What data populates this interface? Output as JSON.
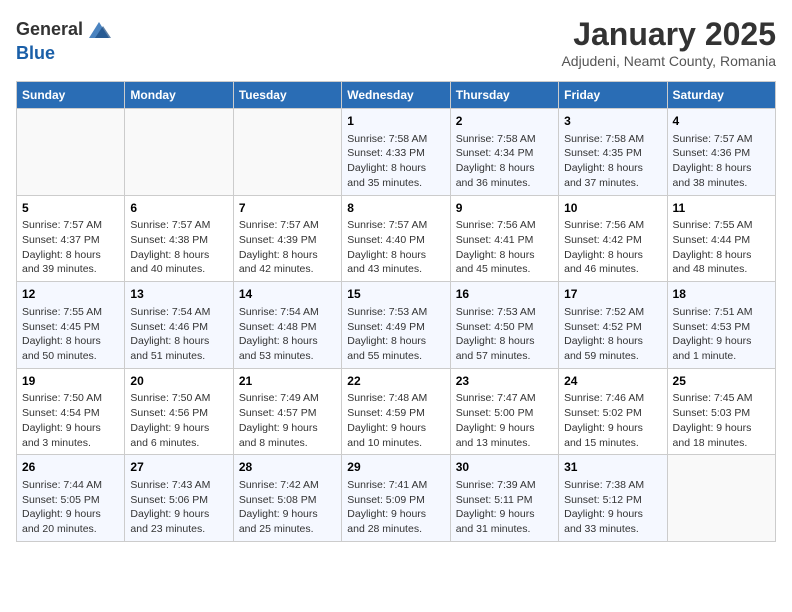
{
  "header": {
    "logo_general": "General",
    "logo_blue": "Blue",
    "month_title": "January 2025",
    "subtitle": "Adjudeni, Neamt County, Romania"
  },
  "calendar": {
    "days_of_week": [
      "Sunday",
      "Monday",
      "Tuesday",
      "Wednesday",
      "Thursday",
      "Friday",
      "Saturday"
    ],
    "weeks": [
      [
        {
          "day": "",
          "info": ""
        },
        {
          "day": "",
          "info": ""
        },
        {
          "day": "",
          "info": ""
        },
        {
          "day": "1",
          "info": "Sunrise: 7:58 AM\nSunset: 4:33 PM\nDaylight: 8 hours and 35 minutes."
        },
        {
          "day": "2",
          "info": "Sunrise: 7:58 AM\nSunset: 4:34 PM\nDaylight: 8 hours and 36 minutes."
        },
        {
          "day": "3",
          "info": "Sunrise: 7:58 AM\nSunset: 4:35 PM\nDaylight: 8 hours and 37 minutes."
        },
        {
          "day": "4",
          "info": "Sunrise: 7:57 AM\nSunset: 4:36 PM\nDaylight: 8 hours and 38 minutes."
        }
      ],
      [
        {
          "day": "5",
          "info": "Sunrise: 7:57 AM\nSunset: 4:37 PM\nDaylight: 8 hours and 39 minutes."
        },
        {
          "day": "6",
          "info": "Sunrise: 7:57 AM\nSunset: 4:38 PM\nDaylight: 8 hours and 40 minutes."
        },
        {
          "day": "7",
          "info": "Sunrise: 7:57 AM\nSunset: 4:39 PM\nDaylight: 8 hours and 42 minutes."
        },
        {
          "day": "8",
          "info": "Sunrise: 7:57 AM\nSunset: 4:40 PM\nDaylight: 8 hours and 43 minutes."
        },
        {
          "day": "9",
          "info": "Sunrise: 7:56 AM\nSunset: 4:41 PM\nDaylight: 8 hours and 45 minutes."
        },
        {
          "day": "10",
          "info": "Sunrise: 7:56 AM\nSunset: 4:42 PM\nDaylight: 8 hours and 46 minutes."
        },
        {
          "day": "11",
          "info": "Sunrise: 7:55 AM\nSunset: 4:44 PM\nDaylight: 8 hours and 48 minutes."
        }
      ],
      [
        {
          "day": "12",
          "info": "Sunrise: 7:55 AM\nSunset: 4:45 PM\nDaylight: 8 hours and 50 minutes."
        },
        {
          "day": "13",
          "info": "Sunrise: 7:54 AM\nSunset: 4:46 PM\nDaylight: 8 hours and 51 minutes."
        },
        {
          "day": "14",
          "info": "Sunrise: 7:54 AM\nSunset: 4:48 PM\nDaylight: 8 hours and 53 minutes."
        },
        {
          "day": "15",
          "info": "Sunrise: 7:53 AM\nSunset: 4:49 PM\nDaylight: 8 hours and 55 minutes."
        },
        {
          "day": "16",
          "info": "Sunrise: 7:53 AM\nSunset: 4:50 PM\nDaylight: 8 hours and 57 minutes."
        },
        {
          "day": "17",
          "info": "Sunrise: 7:52 AM\nSunset: 4:52 PM\nDaylight: 8 hours and 59 minutes."
        },
        {
          "day": "18",
          "info": "Sunrise: 7:51 AM\nSunset: 4:53 PM\nDaylight: 9 hours and 1 minute."
        }
      ],
      [
        {
          "day": "19",
          "info": "Sunrise: 7:50 AM\nSunset: 4:54 PM\nDaylight: 9 hours and 3 minutes."
        },
        {
          "day": "20",
          "info": "Sunrise: 7:50 AM\nSunset: 4:56 PM\nDaylight: 9 hours and 6 minutes."
        },
        {
          "day": "21",
          "info": "Sunrise: 7:49 AM\nSunset: 4:57 PM\nDaylight: 9 hours and 8 minutes."
        },
        {
          "day": "22",
          "info": "Sunrise: 7:48 AM\nSunset: 4:59 PM\nDaylight: 9 hours and 10 minutes."
        },
        {
          "day": "23",
          "info": "Sunrise: 7:47 AM\nSunset: 5:00 PM\nDaylight: 9 hours and 13 minutes."
        },
        {
          "day": "24",
          "info": "Sunrise: 7:46 AM\nSunset: 5:02 PM\nDaylight: 9 hours and 15 minutes."
        },
        {
          "day": "25",
          "info": "Sunrise: 7:45 AM\nSunset: 5:03 PM\nDaylight: 9 hours and 18 minutes."
        }
      ],
      [
        {
          "day": "26",
          "info": "Sunrise: 7:44 AM\nSunset: 5:05 PM\nDaylight: 9 hours and 20 minutes."
        },
        {
          "day": "27",
          "info": "Sunrise: 7:43 AM\nSunset: 5:06 PM\nDaylight: 9 hours and 23 minutes."
        },
        {
          "day": "28",
          "info": "Sunrise: 7:42 AM\nSunset: 5:08 PM\nDaylight: 9 hours and 25 minutes."
        },
        {
          "day": "29",
          "info": "Sunrise: 7:41 AM\nSunset: 5:09 PM\nDaylight: 9 hours and 28 minutes."
        },
        {
          "day": "30",
          "info": "Sunrise: 7:39 AM\nSunset: 5:11 PM\nDaylight: 9 hours and 31 minutes."
        },
        {
          "day": "31",
          "info": "Sunrise: 7:38 AM\nSunset: 5:12 PM\nDaylight: 9 hours and 33 minutes."
        },
        {
          "day": "",
          "info": ""
        }
      ]
    ]
  }
}
